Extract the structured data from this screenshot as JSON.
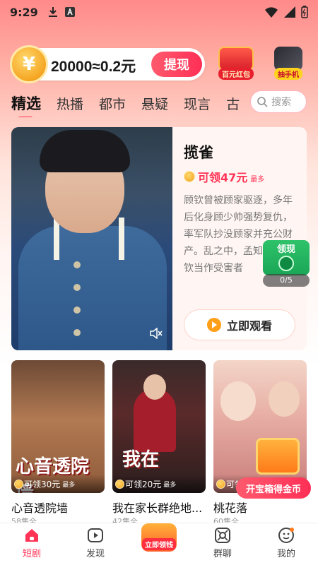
{
  "status_bar": {
    "time": "9:29"
  },
  "coins": {
    "value": "20000≈0.2元",
    "withdraw_label": "提现",
    "coin_symbol": "¥"
  },
  "promos": [
    {
      "label": "百元红包",
      "icon": "red-envelope-icon"
    },
    {
      "label": "抽手机",
      "icon": "phone-prize-icon"
    }
  ],
  "tabs": [
    "精选",
    "热播",
    "都市",
    "悬疑",
    "现言",
    "古"
  ],
  "search": {
    "placeholder": "搜索"
  },
  "featured": {
    "title": "揽雀",
    "earn": "可领47元",
    "earn_suffix": "最多",
    "description": "顾钦曾被顾家驱逐，多年后化身顾少帅强势复仇，率军队抄没顾家并充公财产。乱之中，孟知微诬顾钦当作受害者",
    "watch_label": "立即观看"
  },
  "reward_widget": {
    "label": "领现",
    "progress": "0/5"
  },
  "grid": [
    {
      "title": "心音透院墙",
      "earn": "可领30元",
      "earn_suffix": "最多",
      "poster_text": "心音透院墙",
      "episodes": "58集全"
    },
    {
      "title": "我在家长群绝地...",
      "earn": "可领20元",
      "earn_suffix": "最多",
      "poster_text": "我在",
      "episodes": "42集全"
    },
    {
      "title": "桃花落",
      "earn": "可领",
      "earn_suffix": "",
      "poster_text": "",
      "episodes": "60集全"
    }
  ],
  "chest_button": "开宝箱得金币",
  "nav": [
    {
      "label": "短剧",
      "icon": "home-icon"
    },
    {
      "label": "发现",
      "icon": "play-square-icon"
    },
    {
      "label": "立即领钱",
      "icon": "gift-icon"
    },
    {
      "label": "群聊",
      "icon": "chat-group-icon"
    },
    {
      "label": "我的",
      "icon": "profile-icon"
    }
  ],
  "colors": {
    "accent": "#ff3355",
    "gold": "#f5a623",
    "green": "#1aa656"
  }
}
